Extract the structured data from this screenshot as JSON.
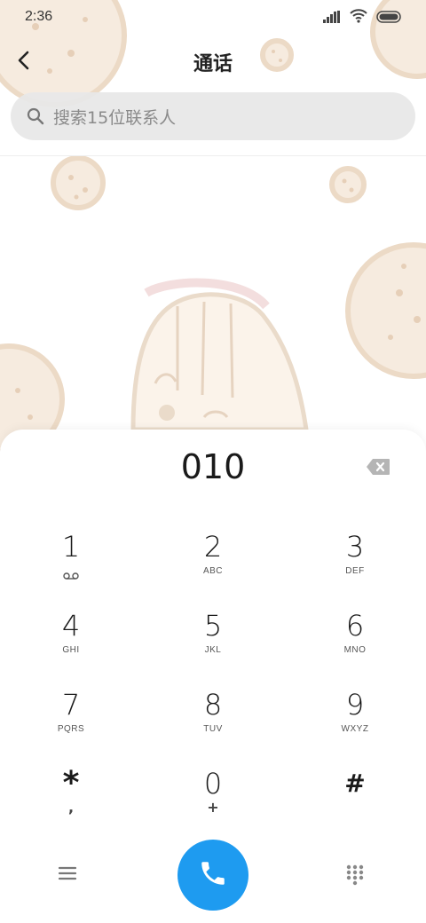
{
  "status_bar": {
    "time": "2:36",
    "icons": [
      "signal-icon",
      "wifi-icon",
      "battery-icon"
    ]
  },
  "header": {
    "title": "通话",
    "back_icon": "chevron-left-icon"
  },
  "search": {
    "placeholder": "搜索15位联系人",
    "icon": "search-icon"
  },
  "dialpad": {
    "number": "010",
    "keys": [
      {
        "digit": "1",
        "sub": "",
        "icon": "voicemail-icon"
      },
      {
        "digit": "2",
        "sub": "ABC"
      },
      {
        "digit": "3",
        "sub": "DEF"
      },
      {
        "digit": "4",
        "sub": "GHI"
      },
      {
        "digit": "5",
        "sub": "JKL"
      },
      {
        "digit": "6",
        "sub": "MNO"
      },
      {
        "digit": "7",
        "sub": "PQRS"
      },
      {
        "digit": "8",
        "sub": "TUV"
      },
      {
        "digit": "9",
        "sub": "WXYZ"
      },
      {
        "digit": "*",
        "sub": ","
      },
      {
        "digit": "0",
        "sub": "+"
      },
      {
        "digit": "#",
        "sub": ""
      }
    ]
  },
  "colors": {
    "call_button": "#1e9bf0",
    "wallpaper_cookie": "#f3e6d8",
    "cookie_outline": "#ead7c2"
  }
}
